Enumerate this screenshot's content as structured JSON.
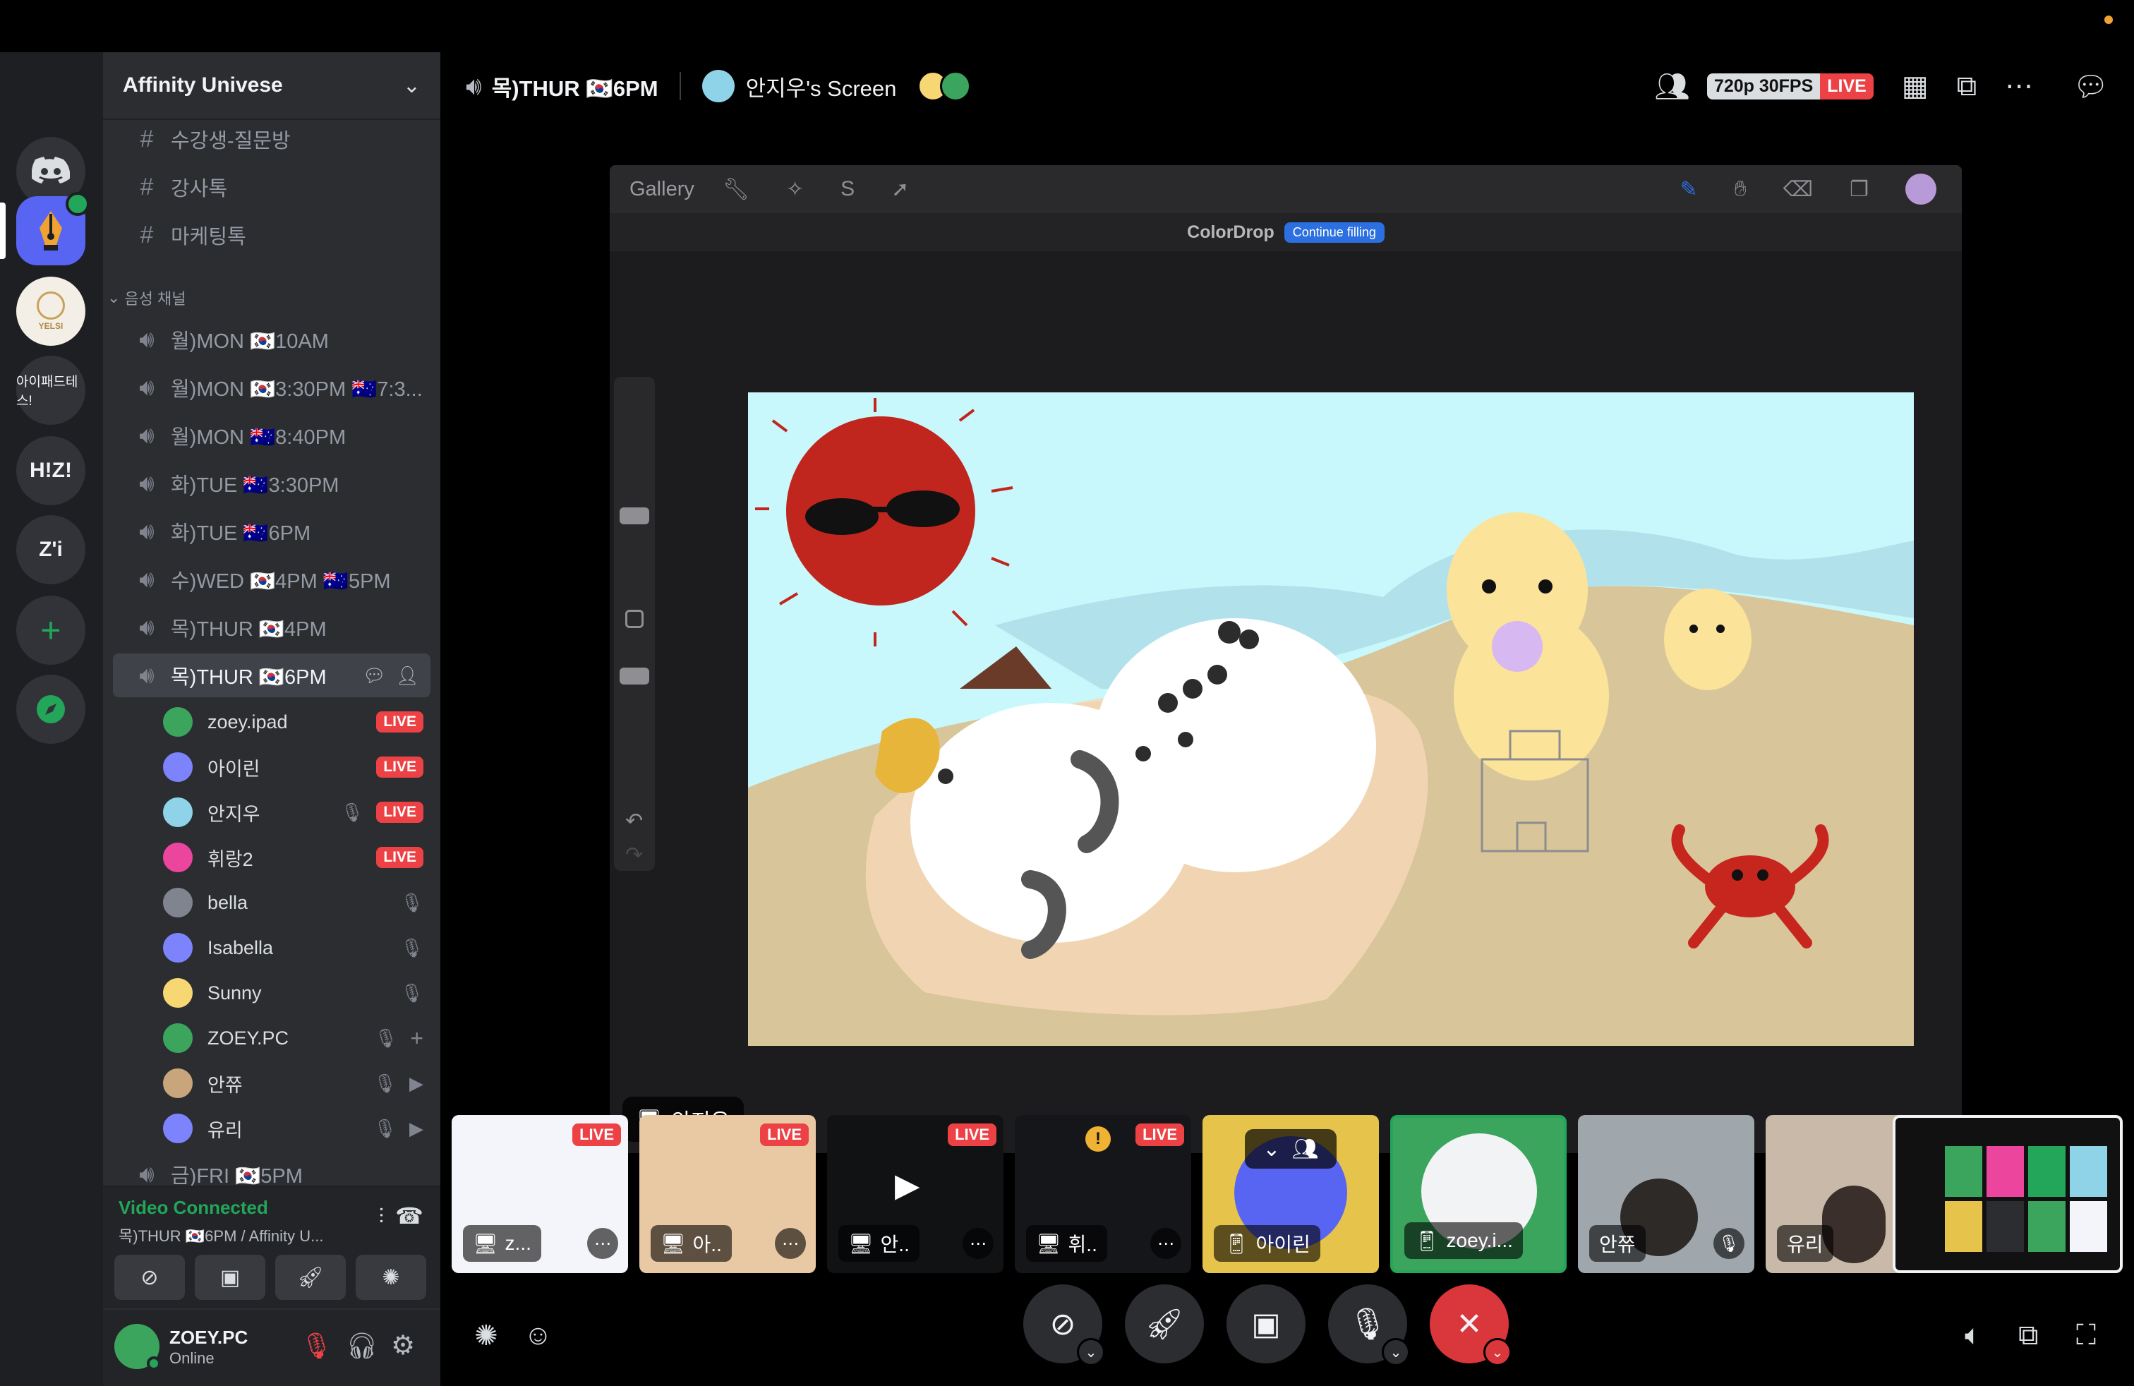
{
  "guild": {
    "name": "Affinity Univese"
  },
  "text_channels": [
    {
      "name": "수강생-질문방"
    },
    {
      "name": "강사톡"
    },
    {
      "name": "마케팅톡"
    }
  ],
  "voice_category": "음성 채널",
  "voice_channels": [
    {
      "name": "월)MON 🇰🇷10AM"
    },
    {
      "name": "월)MON 🇰🇷3:30PM 🇦🇺7:3..."
    },
    {
      "name": "월)MON 🇦🇺8:40PM"
    },
    {
      "name": "화)TUE 🇦🇺3:30PM"
    },
    {
      "name": "화)TUE 🇦🇺6PM"
    },
    {
      "name": "수)WED 🇰🇷4PM 🇦🇺5PM"
    },
    {
      "name": "목)THUR 🇰🇷4PM"
    },
    {
      "name": "목)THUR 🇰🇷6PM"
    },
    {
      "name": "금)FRI 🇰🇷5PM"
    }
  ],
  "members": [
    {
      "name": "zoey.ipad",
      "live": "LIVE",
      "color": "#3ba55d"
    },
    {
      "name": "아이린",
      "live": "LIVE",
      "color": "#7c83fd"
    },
    {
      "name": "안지우",
      "live": "LIVE",
      "color": "#8fd3e8"
    },
    {
      "name": "휘랑2",
      "live": "LIVE",
      "color": "#eb459e"
    },
    {
      "name": "bella",
      "live": "",
      "color": "#80848e"
    },
    {
      "name": "Isabella",
      "live": "",
      "color": "#7c83fd"
    },
    {
      "name": "Sunny",
      "live": "",
      "color": "#f7d774"
    },
    {
      "name": "ZOEY.PC",
      "live": "",
      "color": "#3ba55d"
    },
    {
      "name": "안쮸",
      "live": "",
      "color": "#c9a57b"
    },
    {
      "name": "유리",
      "live": "",
      "color": "#7c83fd"
    }
  ],
  "rail": [
    {
      "label": ""
    },
    {
      "label": ""
    },
    {
      "label": "YELSI"
    },
    {
      "label": "아이패드테스!"
    },
    {
      "label": "H!Z!"
    },
    {
      "label": "Z'i"
    }
  ],
  "voice_panel": {
    "status": "Video Connected",
    "sub": "목)THUR 🇰🇷6PM / Affinity U..."
  },
  "user": {
    "name": "ZOEY.PC",
    "status": "Online"
  },
  "topbar": {
    "channel": "목)THUR 🇰🇷6PM",
    "screen": "안지우's Screen",
    "quality": "720p 30FPS",
    "live": "LIVE"
  },
  "procreate": {
    "gallery": "Gallery",
    "colordrop": "ColorDrop",
    "continue": "Continue filling"
  },
  "presenter": "안지우",
  "thumbnails": [
    {
      "label": "z...",
      "live": "LIVE"
    },
    {
      "label": "아..",
      "live": "LIVE"
    },
    {
      "label": "안..",
      "live": "LIVE"
    },
    {
      "label": "휘..",
      "live": "LIVE"
    },
    {
      "label": "아이린",
      "live": ""
    },
    {
      "label": "zoey.i...",
      "live": ""
    },
    {
      "label": "안쮸",
      "live": ""
    },
    {
      "label": "유리",
      "live": ""
    }
  ],
  "colors": {
    "accent": "#5865f2",
    "live": "#ed4245",
    "connected": "#23a55a",
    "sidebar": "#2b2d31",
    "rail": "#1e1f22"
  }
}
